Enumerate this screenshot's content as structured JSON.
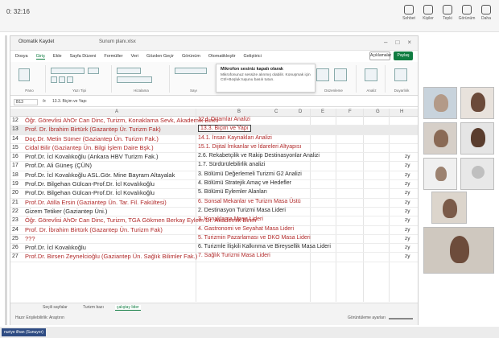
{
  "meeting": {
    "time": "0: 32:16",
    "actions": [
      "Sohbet",
      "Kişiler",
      "Tepki",
      "Görünüm",
      "Daha"
    ]
  },
  "excel": {
    "autosave_label": "Otomatik Kaydet",
    "file_name": "Sunum planı.xlsx",
    "menu": [
      "Dosya",
      "Giriş",
      "Ekle",
      "Sayfa Düzeni",
      "Formüller",
      "Veri",
      "Gözden Geçir",
      "Görünüm",
      "Otomatikleştir",
      "Geliştirici"
    ],
    "comments_label": "Açıklamalar",
    "share_label": "Paylaş",
    "ribbon_groups": [
      "Pano",
      "Yazı Tipi",
      "Hizalama",
      "Sayı",
      "Stiller",
      "Hücreler",
      "Düzenleme",
      "Analiz",
      "Duyarlılık"
    ],
    "cell_ref": "B13",
    "formula_text": "13.3. Biçim ve Yapı",
    "tooltip": {
      "title": "Mikrofon sesiniz kapalı olarak",
      "body": "Mikrofonunuz sessize alınmış olabilir. Konuşmak için Ctrl+Boşluk tuşunu basılı tutun."
    },
    "columns": [
      "A",
      "B",
      "C",
      "D",
      "E",
      "F",
      "G",
      "H"
    ],
    "rows": [
      {
        "num": "12",
        "a": "Öğr. Görevlisi AhOr Can Dinc, Turizm, Konaklama Sevk, Akademik Birim",
        "b": "12.1 Ortamlar Analizi",
        "s": "",
        "a_color": "red",
        "b_color": "red"
      },
      {
        "num": "13",
        "a": "Prof. Dr. İbrahim Birtürk (Gazantep Ür. Turizm Fak)",
        "b": "13.3. Biçim ve Yapı",
        "s": "",
        "a_color": "red",
        "b_color": "red"
      },
      {
        "num": "14",
        "a": "Doç.Dr. Metin Sümer (Gaziantep Ün. Turizm Fak.)",
        "b": "14.1. İnsan Kaynakları Analizi",
        "s": "",
        "a_color": "red",
        "b_color": "red"
      },
      {
        "num": "15",
        "a": "Cidal Bilir (Gaziantep Ün. Bilgi İşlem Daire Bşk.)",
        "b": "15.1. Dijital İmkanlar ve İdareleri Altyapısı",
        "s": "",
        "a_color": "red",
        "b_color": "red"
      },
      {
        "num": "16",
        "a": "Prof.Dr. İcl Kovalıkoğlu (Ankara HBV Turizm Fak.)",
        "b": "2.6. Rekabetçilik ve Rakip Destinasyonlar Analizi",
        "s": "zy",
        "a_color": "dark",
        "b_color": "dark"
      },
      {
        "num": "17",
        "a": "Prof.Dr. Ali Güneş (ÇÜN)",
        "b": "1.7. Sürdürülebilirlik analizi",
        "s": "zy",
        "a_color": "dark",
        "b_color": "dark"
      },
      {
        "num": "18",
        "a": "Prof.Dr. İcl Kovalıkoğlu ASL.Gör. Mine Bayram Altayalak",
        "b": "3. Bölümü Değerlemeli Turizmi G2 Analizi",
        "s": "zy",
        "a_color": "dark",
        "b_color": "dark"
      },
      {
        "num": "19",
        "a": "Prof.Dr. Bilgehan Gülcan-Prof.Dr. İcl Kovalıkoğlu",
        "b": "4. Bölümü Stratejik Amaç ve Hedefler",
        "s": "zy",
        "a_color": "dark",
        "b_color": "dark"
      },
      {
        "num": "20",
        "a": "Prof.Dr. Bilgehan Gülcan-Prof.Dr. İcl Kovalıkoğlu",
        "b": "5. Bölümü Eylemler Alanları",
        "s": "zy",
        "a_color": "dark",
        "b_color": "dark"
      },
      {
        "num": "21",
        "a": "Prof.Dr. Atilla Ersin (Gaziantep Ün. Tar. Fil. Fakültesi)",
        "b": "6. Sonsal Mekanlar ve Turizm Masa Üstü",
        "s": "zy",
        "a_color": "red",
        "b_color": "red"
      },
      {
        "num": "22",
        "a": "Gizem Tetiker (Gaziantep Üni.)",
        "b": "2. Destinasyon Turizmi Masa Lideri",
        "s": "zy",
        "a_color": "dark",
        "b_color": "dark"
      },
      {
        "num": "23",
        "a": "Öğr. Görevlisi AhOr Can Dinc, Turizm, TGA Gökmen Berkay Eylem Dr. Akademik Birim",
        "b": "3. Konaklama Masa Lideri",
        "s": "zy",
        "a_color": "red",
        "b_color": "red"
      },
      {
        "num": "24",
        "a": "Prof. Dr. İbrahim Birtürk (Gazantep Ün. Turizm Fak)",
        "b": "4. Gastronomi ve Seyahat Masa Lideri",
        "s": "zy",
        "a_color": "red",
        "b_color": "red"
      },
      {
        "num": "25",
        "a": "???",
        "b": "5. Turizmin Pazarlaması ve DKO Masa Lideri",
        "s": "zy",
        "a_color": "red",
        "b_color": "red"
      },
      {
        "num": "26",
        "a": "Prof.Dr. İcl Kovalıkoğlu",
        "b": "6. Turizmle İlişkili Kalkınma ve Bireysellik Masa Lideri",
        "s": "zy",
        "a_color": "dark",
        "b_color": "dark"
      },
      {
        "num": "27",
        "a": "Prof.Dr. Birsen Zeynelcioğlu (Gaziantep Ün. Sağlık Bilimler Fak.)",
        "b": "7. Sağlık Turizmi Masa Lideri",
        "s": "zy",
        "a_color": "red",
        "b_color": "red"
      }
    ],
    "sheet_tabs": [
      "Seçili sayfalar",
      "Turizm bazı",
      "çalıştay lider"
    ],
    "status_left": "Hazır   Erişilebilirlik: Araştırın",
    "status_right": "Görüntüleme ayarları"
  },
  "presenter_label": "nuriye ilhan (Sunuyor)",
  "participant_count": "2"
}
